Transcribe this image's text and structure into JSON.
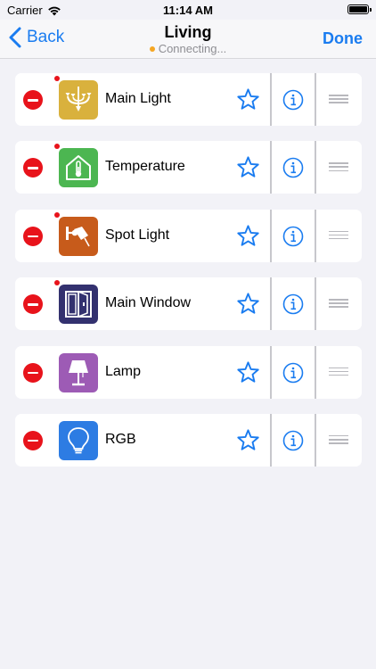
{
  "status_bar": {
    "carrier": "Carrier",
    "time": "11:14 AM"
  },
  "nav": {
    "back_label": "Back",
    "title": "Living",
    "subtitle": "Connecting...",
    "done_label": "Done"
  },
  "colors": {
    "accent": "#1a7cf0",
    "delete": "#e8131b",
    "connecting_dot": "#f5a623"
  },
  "devices": [
    {
      "label": "Main Light",
      "icon": "chandelier-icon",
      "icon_bg": "#d9b13d",
      "alert": true
    },
    {
      "label": "Temperature",
      "icon": "house-thermometer-icon",
      "icon_bg": "#4cb651",
      "alert": true
    },
    {
      "label": "Spot Light",
      "icon": "spotlight-icon",
      "icon_bg": "#c75b1b",
      "alert": true
    },
    {
      "label": "Main Window",
      "icon": "window-icon",
      "icon_bg": "#33316f",
      "alert": true
    },
    {
      "label": "Lamp",
      "icon": "lamp-icon",
      "icon_bg": "#9d5bb5",
      "alert": false
    },
    {
      "label": "RGB",
      "icon": "lightbulb-icon",
      "icon_bg": "#2d7ce3",
      "alert": false
    }
  ]
}
